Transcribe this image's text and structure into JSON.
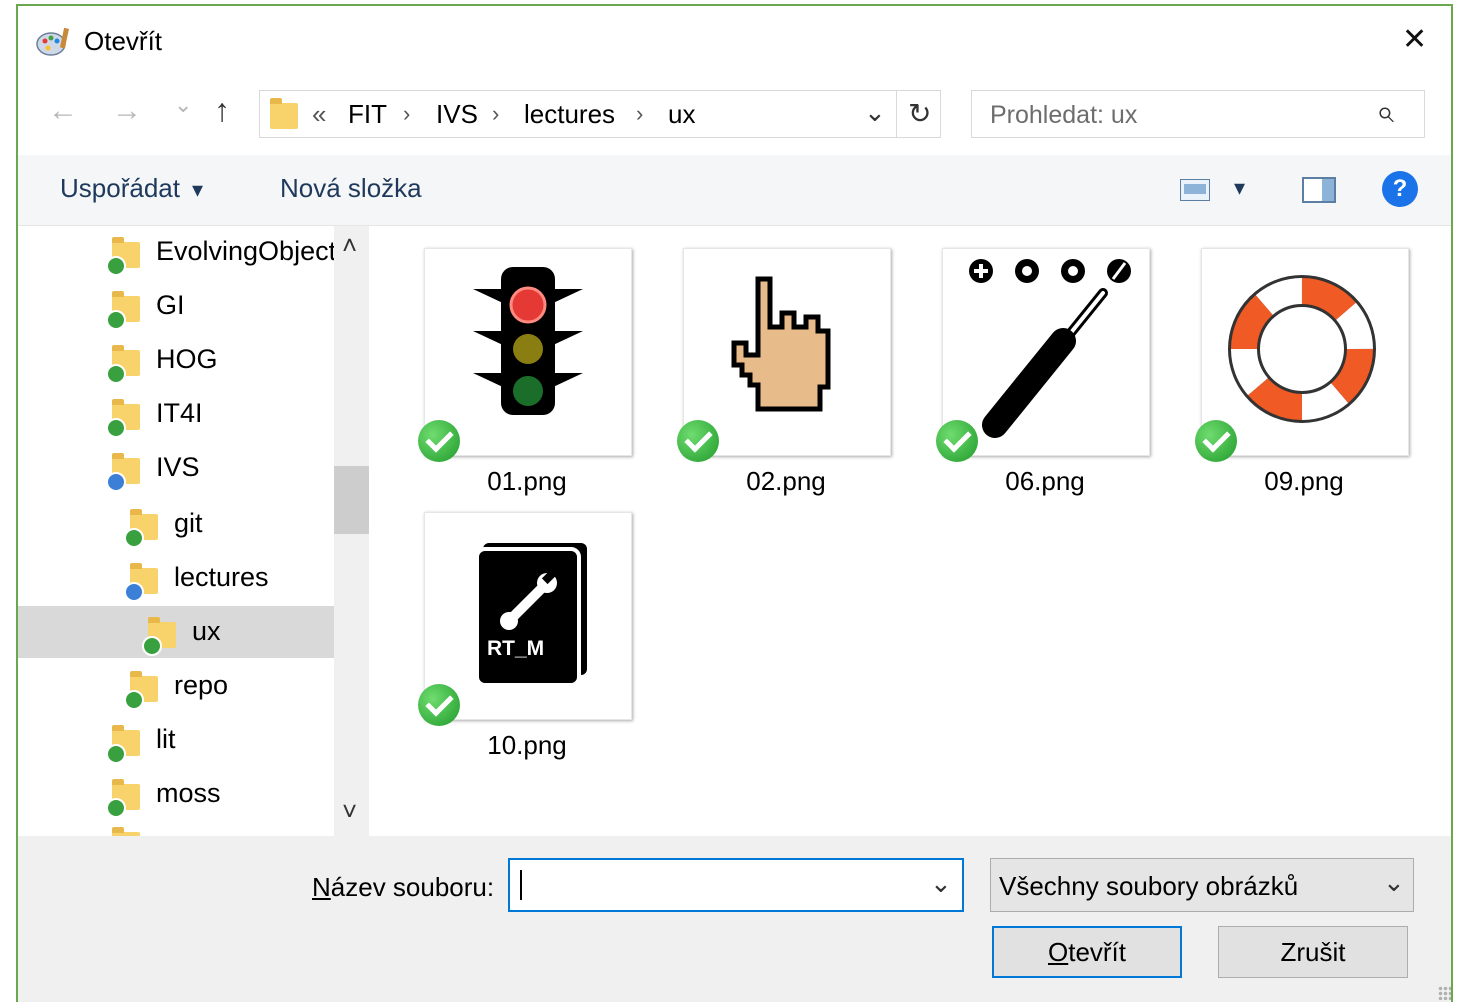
{
  "window": {
    "title": "Otevřít",
    "close_glyph": "✕"
  },
  "nav": {
    "back": "←",
    "forward": "→",
    "recent": "⌄",
    "up": "↑"
  },
  "address": {
    "overflow": "«",
    "crumbs": [
      "FIT",
      "IVS",
      "lectures",
      "ux"
    ],
    "separator": "›",
    "dropdown": "⌄",
    "refresh": "↻"
  },
  "search": {
    "placeholder": "Prohledat: ux",
    "icon": "⌕"
  },
  "toolbar": {
    "organize": "Uspořádat",
    "organize_arrow": "▾",
    "new_folder": "Nová složka",
    "view_arrow": "▾",
    "help": "?"
  },
  "tree": [
    {
      "label": "EvolvingObject",
      "badge": "green"
    },
    {
      "label": "GI",
      "badge": "green"
    },
    {
      "label": "HOG",
      "badge": "green"
    },
    {
      "label": "IT4I",
      "badge": "green"
    },
    {
      "label": "IVS",
      "badge": "blue"
    },
    {
      "label": "git",
      "badge": "green"
    },
    {
      "label": "lectures",
      "badge": "blue"
    },
    {
      "label": "ux",
      "badge": "green",
      "selected": true
    },
    {
      "label": "repo",
      "badge": "green"
    },
    {
      "label": "lit",
      "badge": "green"
    },
    {
      "label": "moss",
      "badge": "green"
    }
  ],
  "scrollbar": {
    "up": "˄",
    "down": "˅"
  },
  "files": [
    {
      "name": "01.png",
      "icon": "traffic-light-icon"
    },
    {
      "name": "02.png",
      "icon": "pointing-hand-icon"
    },
    {
      "name": "06.png",
      "icon": "screwdriver-icon"
    },
    {
      "name": "09.png",
      "icon": "lifebuoy-icon"
    },
    {
      "name": "10.png",
      "icon": "manual-book-icon",
      "label": "RT_M"
    }
  ],
  "footer": {
    "filename_label_accel": "N",
    "filename_label_rest": "ázev souboru:",
    "filename_value": "",
    "filter_value": "Všechny soubory obrázků",
    "dropdown": "⌄",
    "open_accel": "O",
    "open_rest": "tevřít",
    "cancel": "Zrušit"
  },
  "colors": {
    "accent": "#0078d7",
    "window_border": "#6aa84f",
    "ok_badge": "#2da83a",
    "sync_badge": "#3c7fd6"
  }
}
